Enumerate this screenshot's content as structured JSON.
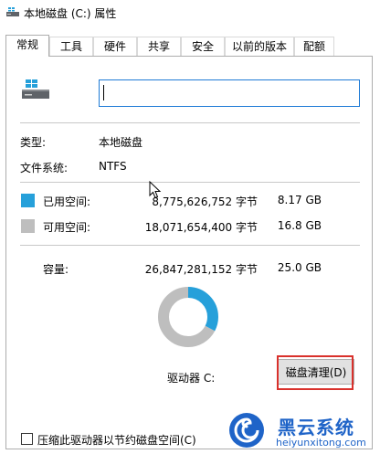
{
  "window": {
    "title": "本地磁盘 (C:) 属性"
  },
  "tabs": [
    {
      "label": "常规",
      "active": true
    },
    {
      "label": "工具"
    },
    {
      "label": "硬件"
    },
    {
      "label": "共享"
    },
    {
      "label": "安全"
    },
    {
      "label": "以前的版本"
    },
    {
      "label": "配额"
    }
  ],
  "general": {
    "name_value": "",
    "type_label": "类型:",
    "type_value": "本地磁盘",
    "fs_label": "文件系统:",
    "fs_value": "NTFS",
    "used": {
      "label": "已用空间:",
      "bytes": "8,775,626,752 字节",
      "size": "8.17 GB",
      "color": "#26a0da"
    },
    "free": {
      "label": "可用空间:",
      "bytes": "18,071,654,400 字节",
      "size": "16.8 GB",
      "color": "#bebebe"
    },
    "capacity": {
      "label": "容量:",
      "bytes": "26,847,281,152 字节",
      "size": "25.0 GB"
    },
    "drive_label": "驱动器 C:",
    "cleanup_button": "磁盘清理(D)",
    "compress_label": "压缩此驱动器以节约磁盘空间(C)",
    "compress_checked": false
  },
  "chart_data": {
    "type": "pie",
    "categories": [
      "已用空间",
      "可用空间"
    ],
    "values": [
      8775626752,
      18071654400
    ],
    "colors": [
      "#26a0da",
      "#bebebe"
    ]
  },
  "watermark": {
    "title": "黑云系统",
    "url": "heiyunxitong.com"
  },
  "colors": {
    "accent": "#1e7ad6",
    "highlight": "#d9312c"
  }
}
